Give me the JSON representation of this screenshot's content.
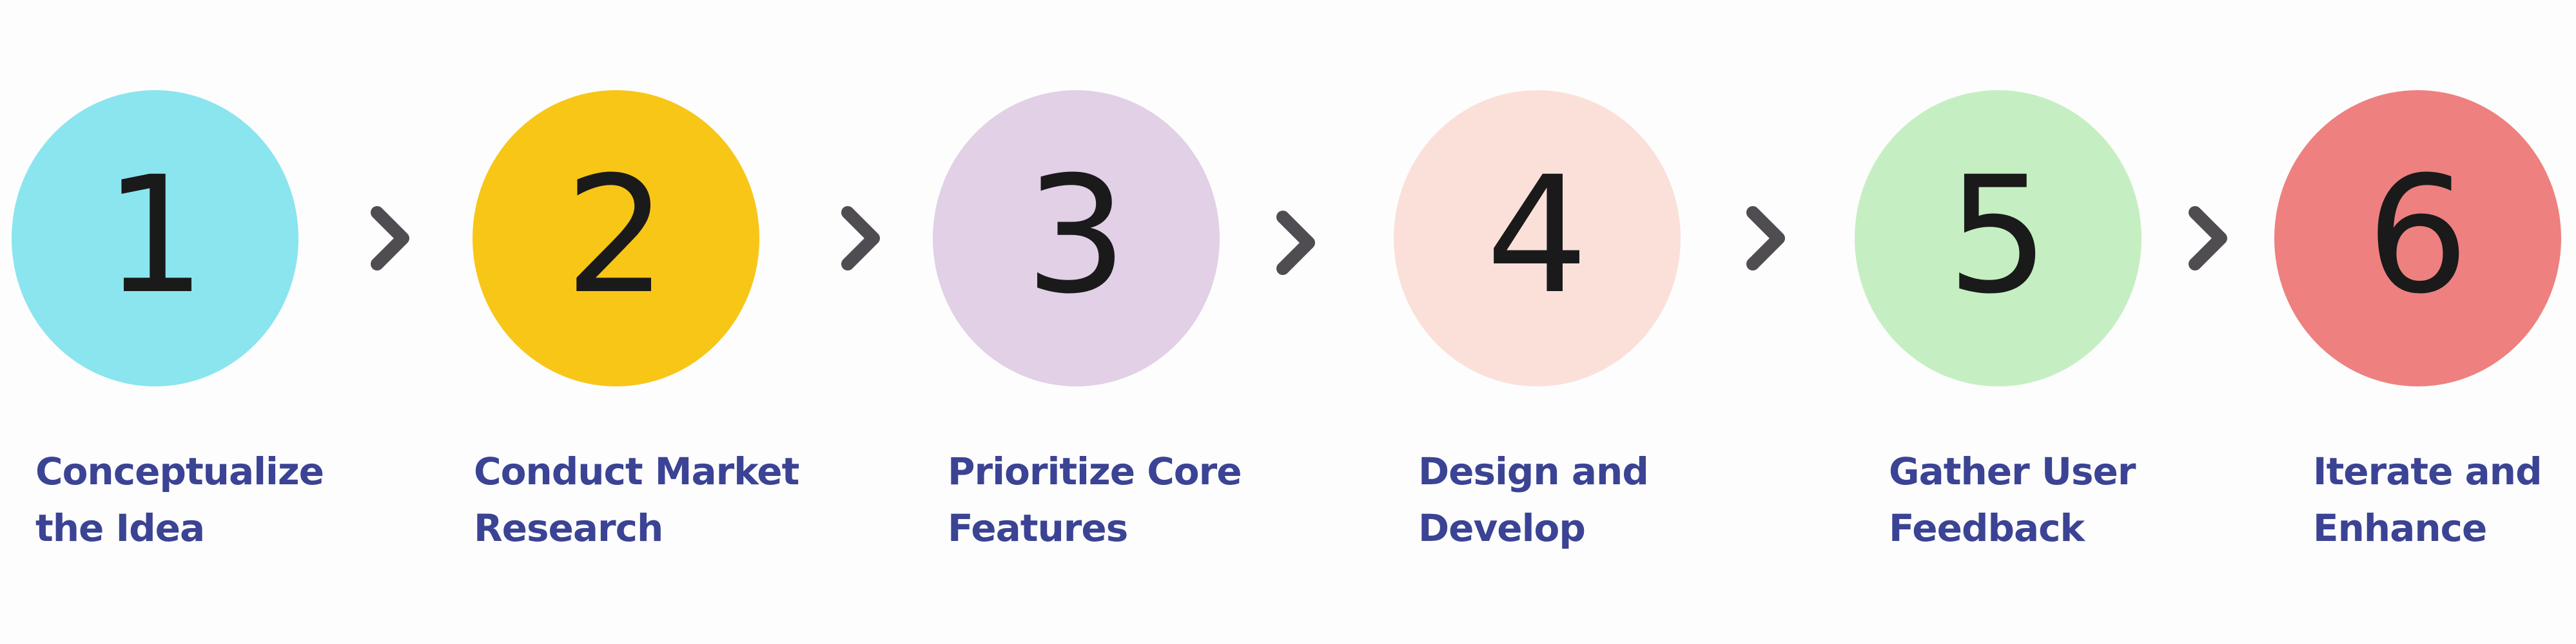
{
  "diagram": {
    "type": "process-flow",
    "steps": [
      {
        "number": "1",
        "label_line1": "Conceptualize",
        "label_line2": "the Idea",
        "color": "#8ae5ef"
      },
      {
        "number": "2",
        "label_line1": "Conduct Market",
        "label_line2": "Research",
        "color": "#f8c617"
      },
      {
        "number": "3",
        "label_line1": "Prioritize Core",
        "label_line2": "Features",
        "color": "#e1d0e6"
      },
      {
        "number": "4",
        "label_line1": "Design and",
        "label_line2": "Develop",
        "color": "#fbe0da"
      },
      {
        "number": "5",
        "label_line1": "Gather User",
        "label_line2": "Feedback",
        "color": "#c5efc2"
      },
      {
        "number": "6",
        "label_line1": "Iterate and",
        "label_line2": "Enhance",
        "color": "#ee8080"
      }
    ],
    "connector_icon": "chevron-right-icon",
    "connector_color": "#4f4d51",
    "label_color": "#3b4394",
    "number_color": "#1a1a1a"
  }
}
